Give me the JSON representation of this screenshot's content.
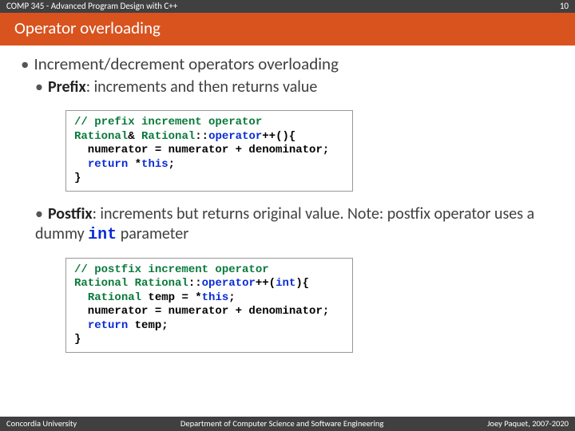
{
  "header": {
    "course": "COMP 345 - Advanced Program Design with C++",
    "slide_number": "10"
  },
  "title": "Operator overloading",
  "main_bullet": "Increment/decrement operators overloading",
  "prefix": {
    "label": "Prefix",
    "desc": ": increments and then returns value"
  },
  "postfix": {
    "label": "Postfix",
    "desc_1": ": increments but returns original value. Note: postfix operator uses a dummy ",
    "int_token": "int",
    "desc_2": " parameter"
  },
  "code1": {
    "c1": "// prefix increment operator",
    "l2a": "Rational",
    "l2b": "& ",
    "l2c": "Rational",
    "l2d": "::",
    "l2e": "operator",
    "l2f": "++(){",
    "l3": "  numerator = numerator + denominator;",
    "l4a": "  ",
    "l4b": "return",
    "l4c": " *",
    "l4d": "this",
    "l4e": ";",
    "l5": "}"
  },
  "code2": {
    "c1": "// postfix increment operator",
    "l2a": "Rational",
    "l2b": " ",
    "l2c": "Rational",
    "l2d": "::",
    "l2e": "operator",
    "l2f": "++(",
    "l2g": "int",
    "l2h": "){",
    "l3a": "  ",
    "l3b": "Rational",
    "l3c": " temp = *",
    "l3d": "this",
    "l3e": ";",
    "l4": "  numerator = numerator + denominator;",
    "l5a": "  ",
    "l5b": "return",
    "l5c": " temp;",
    "l6": "}"
  },
  "footer": {
    "left": "Concordia University",
    "center": "Department of Computer Science and Software Engineering",
    "right": "Joey Paquet, 2007-2020"
  }
}
